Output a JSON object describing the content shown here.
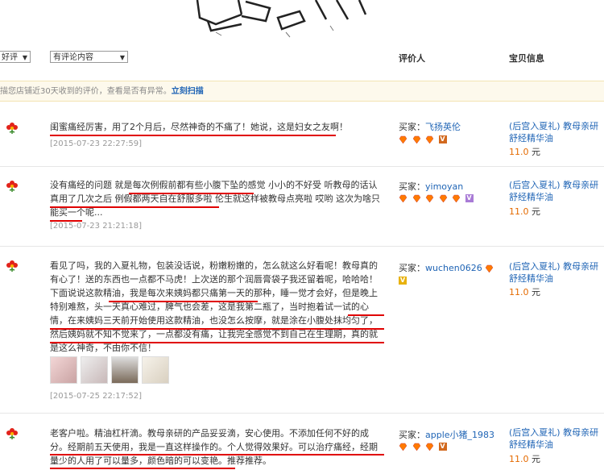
{
  "filters": {
    "rating_select": "好评",
    "content_select": "有评论内容",
    "header_reviewer": "评价人",
    "header_item": "宝贝信息"
  },
  "notice": {
    "text": "描您店铺近30天收到的评价，查看是否有异常。",
    "link": "立刻扫描"
  },
  "buyer_prefix": "买家：",
  "reviews": [
    {
      "text": "闺蜜痛经厉害，用了2个月后，尽然神奇的不痛了！她说，这是妇女之友啊！",
      "date": "[2015-07-23 22:27:59]",
      "buyer": "飞扬英伦",
      "diamonds": 3,
      "product": "(后宫入夏礼) 教母亲研舒经精华油",
      "price": "11.0",
      "unit": "元"
    },
    {
      "text": "没有痛经的问题 就是每次例假前都有些小腹下坠的感觉 小小的不好受 听教母的话认真用了几次之后 例假都两天自在舒服多啦 伦生就这样被教母点亮啦 哎哟 这次为啥只能买一个呢...",
      "date": "[2015-07-23 21:21:18]",
      "buyer": "yimoyan",
      "diamonds": 5,
      "product": "(后宫入夏礼) 教母亲研舒经精华油",
      "price": "11.0",
      "unit": "元"
    },
    {
      "text": "看见了吗，我的入夏礼物，包装没话说，粉嫩粉嫩的，怎么就这么好看呢！教母真的有心了！送的东西也一点都不马虎！上次送的那个润唇膏袋子我还留着呢，哈哈哈！下面说说这款精油，我是每次来姨妈都只痛第一天的那种，睡一觉才会好，但是晚上特别难熬，头一天真心难过，脾气也会差，这是我第二瓶了，当时抱着试一试的心情，在来姨妈三天前开始使用这款精油，也没怎么按摩，就是涂在小腹处抹均匀了，然后姨妈就不知不觉来了，一点都没有痛，让我完全感觉不到自己在生理期，真的就是这么神奇，不由你不信！",
      "date": "[2015-07-25 22:17:52]",
      "buyer": "wuchen0626",
      "diamonds": 1,
      "product": "(后宫入夏礼) 教母亲研舒经精华油",
      "price": "11.0",
      "unit": "元"
    },
    {
      "text": "老客户啦。精油杠杆滴。教母亲研的产品妥妥滴，安心使用。不添加任何不好的成分。经期前五天使用，我是一直这样操作的。个人觉得效果好。可以治疗痛经，经期量少的人用了可以量多，颜色暗的可以变艳。推荐推荐。",
      "date": "",
      "buyer": "apple小猪_1983",
      "diamonds": 3,
      "product": "(后宫入夏礼) 教母亲研舒经精华油",
      "price": "11.0",
      "unit": "元"
    }
  ],
  "colors": {
    "link_blue": "#1f64b5",
    "underline_red": "#e00000",
    "price_orange": "#e46a00",
    "notice_bg": "#fdf9ec"
  }
}
